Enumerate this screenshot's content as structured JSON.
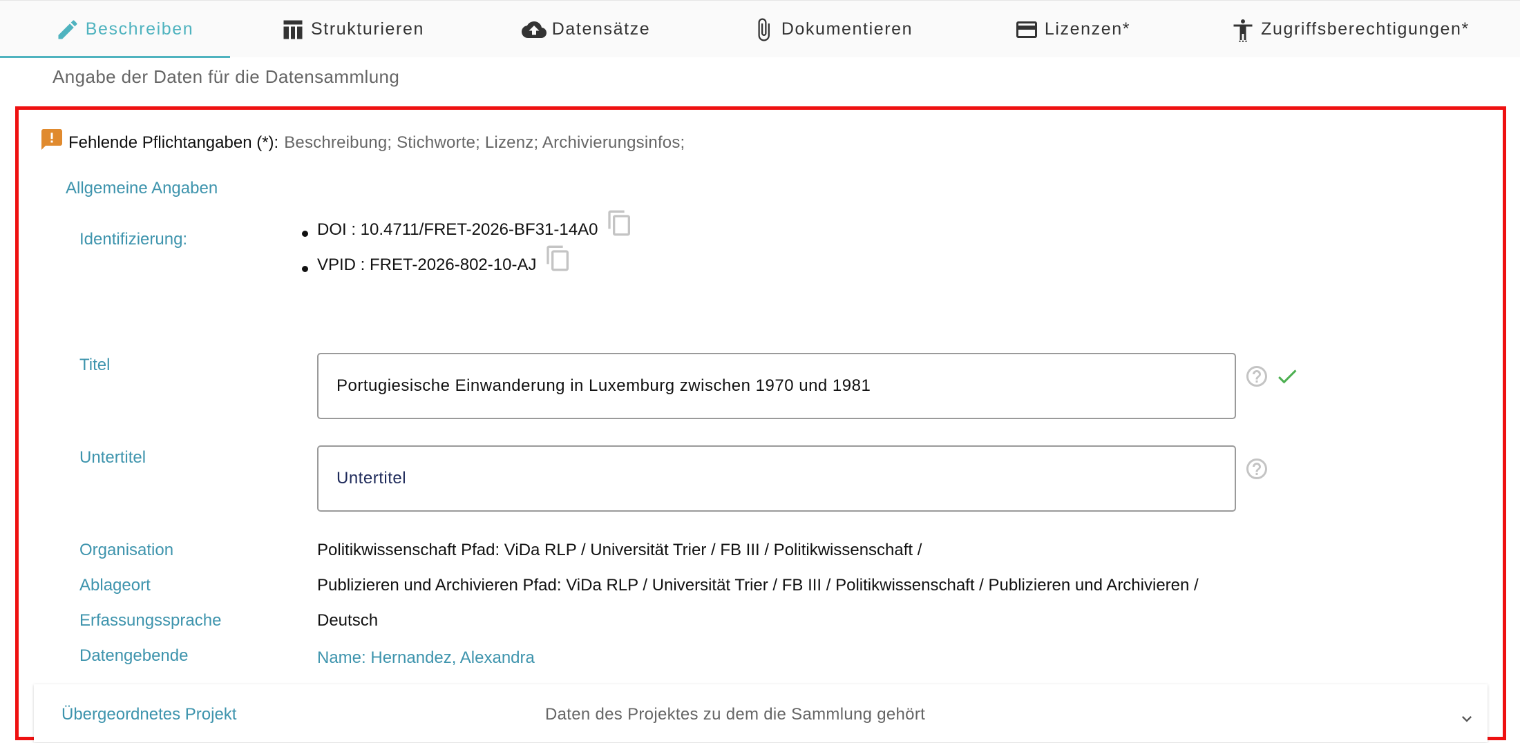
{
  "tabs": [
    {
      "label": "Beschreiben",
      "icon": "pencil-icon",
      "active": true
    },
    {
      "label": "Strukturieren",
      "icon": "table-icon",
      "active": false
    },
    {
      "label": "Datensätze",
      "icon": "cloud-upload-icon",
      "active": false
    },
    {
      "label": "Dokumentieren",
      "icon": "paperclip-icon",
      "active": false
    },
    {
      "label": "Lizenzen*",
      "icon": "credit-card-icon",
      "active": false
    },
    {
      "label": "Zugriffsberechtigungen*",
      "icon": "accessibility-icon",
      "active": false
    }
  ],
  "page": {
    "subtitle": "Angabe der Daten für die Datensammlung"
  },
  "warning": {
    "label": "Fehlende Pflichtangaben (*):",
    "items": "Beschreibung;  Stichworte;  Lizenz;  Archivierungsinfos;"
  },
  "section": {
    "title": "Allgemeine Angaben"
  },
  "identification": {
    "label": "Identifizierung:",
    "items": [
      {
        "text": "DOI : 10.4711/FRET-2026-BF31-14A0"
      },
      {
        "text": "VPID : FRET-2026-802-10-AJ"
      }
    ]
  },
  "titel": {
    "label": "Titel",
    "value": "Portugiesische Einwanderung in Luxemburg zwischen 1970 und 1981"
  },
  "untertitel": {
    "label": "Untertitel",
    "value": "",
    "placeholder": "Untertitel"
  },
  "organisation": {
    "label": "Organisation",
    "value": "Politikwissenschaft Pfad: ViDa RLP / Universität Trier / FB III / Politikwissenschaft /"
  },
  "ablageort": {
    "label": "Ablageort",
    "value": "Publizieren und Archivieren Pfad: ViDa RLP / Universität Trier / FB III / Politikwissenschaft / Publizieren und Archivieren /"
  },
  "erfassungssprache": {
    "label": "Erfassungssprache",
    "value": "Deutsch"
  },
  "datengebende": {
    "label": "Datengebende",
    "value": "Name: Hernandez, Alexandra"
  },
  "accordion": {
    "title": "Übergeordnetes Projekt",
    "description": "Daten des Projektes zu dem die Sammlung gehört"
  },
  "colors": {
    "accent": "#4fb3bf",
    "label": "#3e94ad",
    "warning": "#e08a2e",
    "error_border": "#ee1111",
    "success": "#4caf50"
  }
}
